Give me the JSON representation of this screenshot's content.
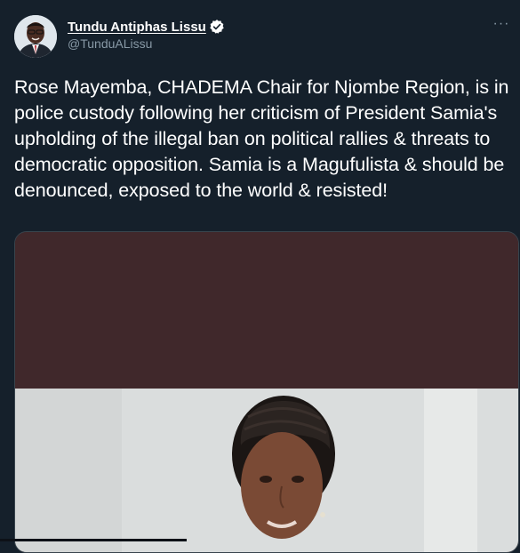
{
  "tweet": {
    "author": {
      "display_name": "Tundu Antiphas Lissu",
      "handle": "@TunduALissu",
      "verified": true,
      "avatar_icon": "profile-photo"
    },
    "more_label": "···",
    "text": "Rose Mayemba, CHADEMA Chair for Njombe Region, is in police custody following her criticism of President Samia's upholding of the illegal ban on political rallies & threats to democratic opposition. Samia is a Magufulista & should be denounced, exposed to the world & resisted!",
    "media": {
      "kind": "photo",
      "top_color": "#40282b",
      "bottom_color": "#d9dcdc"
    }
  },
  "colors": {
    "background": "#15202b",
    "text_primary": "#ffffff",
    "text_secondary": "#8899a6",
    "verified_badge": "#ffffff",
    "border": "#38444d"
  }
}
